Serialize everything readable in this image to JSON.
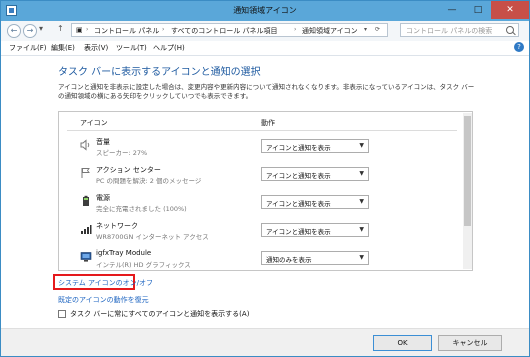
{
  "window": {
    "title": "通知領域アイコン",
    "min_glyph": "—",
    "max_glyph": "□",
    "close_glyph": "✕"
  },
  "nav": {
    "back_glyph": "←",
    "forward_glyph": "→",
    "history_glyph": "▾",
    "up_glyph": "↑",
    "breadcrumbs": [
      "コントロール パネル",
      "すべてのコントロール パネル項目",
      "通知領域アイコン"
    ],
    "dropdown_glyph": "▾",
    "refresh_glyph": "⟳",
    "search_placeholder": "コントロール パネルの検索"
  },
  "menu": {
    "items": [
      "ファイル(F)",
      "編集(E)",
      "表示(V)",
      "ツール(T)",
      "ヘルプ(H)"
    ],
    "help_glyph": "?"
  },
  "main": {
    "heading": "タスク バーに表示するアイコンと通知の選択",
    "description": "アイコンと通知を非表示に設定した場合は、変更内容や更新内容について通知されなくなります。非表示になっているアイコンは、タスク バーの通知領域の横にある矢印をクリックしていつでも表示できます。"
  },
  "table": {
    "col_icon": "アイコン",
    "col_behavior": "動作",
    "rows": [
      {
        "name": "音量",
        "desc": "スピーカー: 27%",
        "behavior": "アイコンと通知を表示",
        "icon": "speaker-icon"
      },
      {
        "name": "アクション センター",
        "desc": "PC の問題を解決: 2 個のメッセージ",
        "behavior": "アイコンと通知を表示",
        "icon": "flag-icon"
      },
      {
        "name": "電源",
        "desc": "完全に充電されました (100%)",
        "behavior": "アイコンと通知を表示",
        "icon": "battery-icon"
      },
      {
        "name": "ネットワーク",
        "desc": "WR8700GN インターネット アクセス",
        "behavior": "アイコンと通知を表示",
        "icon": "network-icon"
      },
      {
        "name": "igfxTray Module",
        "desc": "インテル(R) HD グラフィックス",
        "behavior": "通知のみを表示",
        "icon": "graphics-icon"
      }
    ]
  },
  "links": {
    "system_icons": "システム アイコンのオン/オフ",
    "restore_default": "既定のアイコンの動作を復元"
  },
  "checkbox": {
    "label": "タスク バーに常にすべてのアイコンと通知を表示する(A)",
    "checked": false
  },
  "footer": {
    "ok": "OK",
    "cancel": "キャンセル"
  },
  "colors": {
    "titlebar": "#5aa7d9",
    "heading": "#1e5aa0",
    "link": "#1b63c0",
    "highlight": "#e5191c",
    "close_button": "#c74f48"
  }
}
